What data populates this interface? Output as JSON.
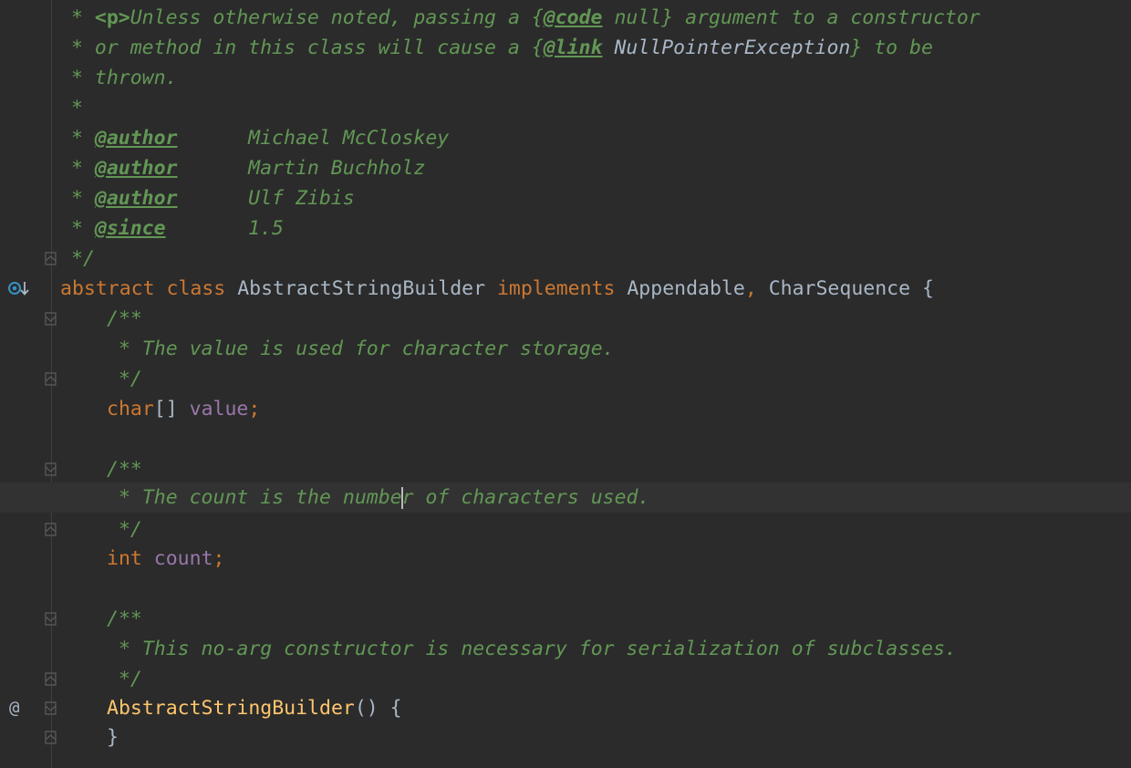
{
  "editor": {
    "language": "Java",
    "theme_colors": {
      "background": "#2b2b2b",
      "doc_comment": "#629755",
      "keyword": "#cc7832",
      "field": "#9876aa",
      "method": "#ffc66d",
      "identifier": "#a9b7c6"
    },
    "gutter": {
      "implemented_marker_icon": "implementing-method-icon",
      "override_marker_icon": "annotation-at-icon",
      "implemented_marker_glyph": "⦿↓",
      "override_marker_glyph": "@"
    },
    "lines": {
      "l1a": "* ",
      "l1b": "<p>",
      "l1c": "Unless otherwise noted, passing a {",
      "l1d": "@code",
      "l1e": " null} argument to a constructor",
      "l2a": "* or method in this class will cause a {",
      "l2b": "@link",
      "l2c": " NullPointerException",
      "l2d": "} to be",
      "l3": "* thrown.",
      "l4": "*",
      "l5a": "* ",
      "l5b": "@author",
      "l5c": "      Michael McCloskey",
      "l6a": "* ",
      "l6b": "@author",
      "l6c": "      Martin Buchholz",
      "l7a": "* ",
      "l7b": "@author",
      "l7c": "      Ulf Zibis",
      "l8a": "* ",
      "l8b": "@since",
      "l8c": "       1.5",
      "l9": "*/",
      "l10a": "abstract",
      "l10b": " ",
      "l10c": "class",
      "l10d": " AbstractStringBuilder ",
      "l10e": "implements",
      "l10f": " Appendable",
      "l10g": ",",
      "l10h": " CharSequence {",
      "l11": "/**",
      "l12": " * The value is used for character storage.",
      "l13": " */",
      "l14a": "char",
      "l14b": "[] ",
      "l14c": "value",
      "l14d": ";",
      "l16": "/**",
      "l17a": " * The count is the numbe",
      "l17b": "r of characters used.",
      "l18": " */",
      "l19a": "int",
      "l19b": " ",
      "l19c": "count",
      "l19d": ";",
      "l21": "/**",
      "l22": " * This no-arg constructor is necessary for serialization of subclasses.",
      "l23": " */",
      "l24a": "AbstractStringBuilder",
      "l24b": "() {",
      "l25": "}"
    }
  }
}
